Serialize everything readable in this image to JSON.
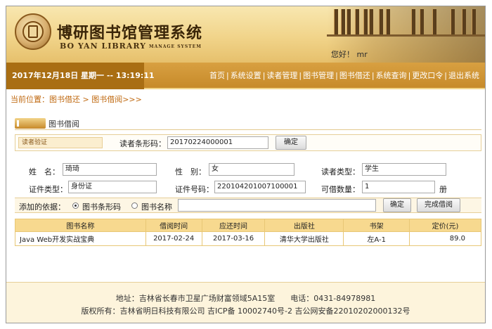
{
  "header": {
    "title_cn": "博研图书馆管理系统",
    "title_en": "BO YAN LIBRARY",
    "title_en_sub": "MANAGE SYSTEM",
    "welcome": "您好！ mr"
  },
  "navbar": {
    "datetime": "2017年12月18日 星期一 -- 13:19:11",
    "links": [
      "首页",
      "系统设置",
      "读者管理",
      "图书管理",
      "图书借还",
      "系统查询",
      "更改口令",
      "退出系统"
    ]
  },
  "breadcrumb": "当前位置：图书借还 > 图书借阅>>>",
  "panel": {
    "title": "图书借阅",
    "verify_tag": "读者验证",
    "barcode_label": "读者条形码：",
    "barcode_value": "20170224000001",
    "confirm_button": "确定",
    "reader": {
      "name_label": "姓　名：",
      "name_value": "琦琦",
      "gender_label": "性　别：",
      "gender_value": "女",
      "type_label": "读者类型：",
      "type_value": "学生",
      "idtype_label": "证件类型：",
      "idtype_value": "身份证",
      "idno_label": "证件号码：",
      "idno_value": "220104201007100001",
      "quota_label": "可借数量：",
      "quota_value": "1",
      "quota_unit": "册"
    },
    "add_by": {
      "label": "添加的依据：",
      "option_barcode": "图书条形码",
      "option_name": "图书名称",
      "input_value": "",
      "confirm_button": "确定",
      "finish_button": "完成借阅"
    },
    "table": {
      "headers": [
        "图书名称",
        "借阅时间",
        "应还时间",
        "出版社",
        "书架",
        "定价(元)"
      ],
      "rows": [
        [
          "Java Web开发实战宝典",
          "2017-02-24",
          "2017-03-16",
          "清华大学出版社",
          "左A-1",
          "89.0"
        ]
      ]
    }
  },
  "footer": {
    "address": "地址：吉林省长春市卫星广场财富领域5A15室　　电话：0431-84978981",
    "copyright": "版权所有：吉林省明日科技有限公司 吉ICP备 10002740号-2 吉公网安备22010202000132号"
  }
}
